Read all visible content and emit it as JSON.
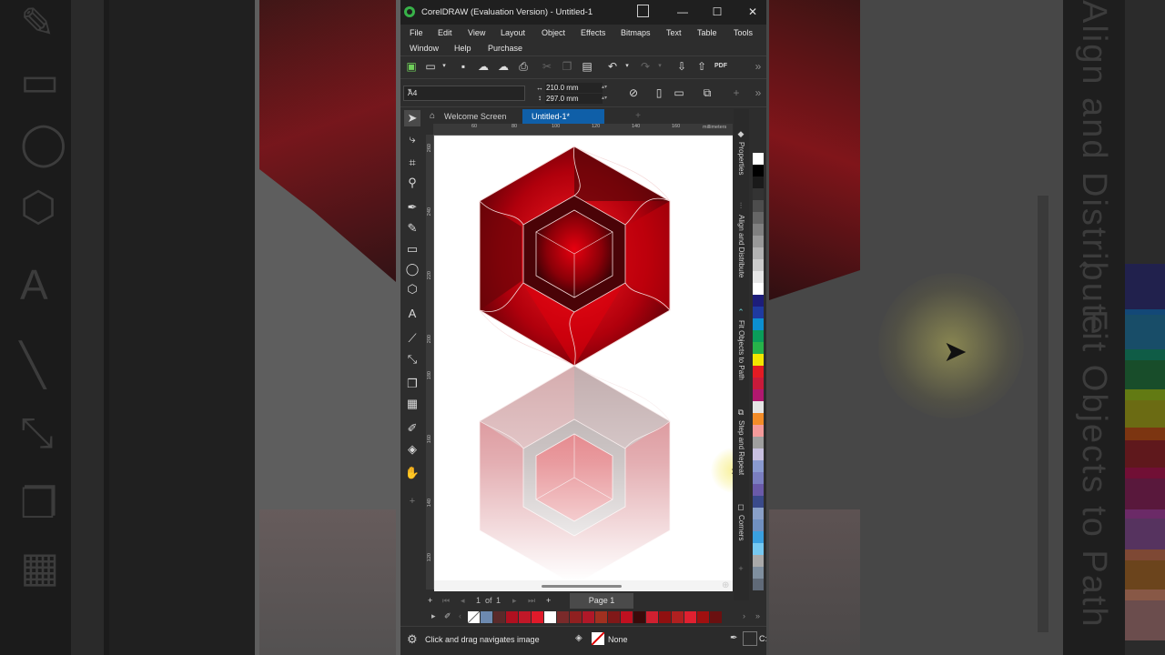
{
  "window": {
    "title": "CorelDRAW (Evaluation Version) - Untitled-1",
    "controls": {
      "minimize": "—",
      "maximize": "☐",
      "close": "✕"
    }
  },
  "menu": [
    "File",
    "Edit",
    "View",
    "Layout",
    "Object",
    "Effects",
    "Bitmaps",
    "Text",
    "Table",
    "Tools",
    "Window",
    "Help",
    "Purchase"
  ],
  "toolbar": {
    "pdf_label": "PDF",
    "icons": [
      "new-document-icon",
      "open-icon",
      "save-icon",
      "cloud-upload-icon",
      "cloud-download-icon",
      "print-icon",
      "cut-icon",
      "copy-icon",
      "paste-icon",
      "undo-icon",
      "redo-icon",
      "import-icon",
      "export-icon",
      "publish-pdf-icon"
    ]
  },
  "property_bar": {
    "page_size": "A4",
    "width": "210.0 mm",
    "height": "297.0 mm"
  },
  "tabs": {
    "welcome": "Welcome Screen",
    "document": "Untitled-1*"
  },
  "rulers": {
    "units": "millimeters",
    "horizontal_ticks": [
      "60",
      "80",
      "100",
      "120",
      "140",
      "160"
    ],
    "vertical_ticks": [
      "260",
      "240",
      "220",
      "200",
      "180",
      "160",
      "140",
      "120"
    ]
  },
  "dockers": [
    "Properties",
    "Align and Distribute",
    "Fit Objects to Path",
    "Step and Repeat",
    "Corners"
  ],
  "page_nav": {
    "current": "1",
    "of_label": "of",
    "total": "1",
    "page_tab": "Page 1"
  },
  "status": {
    "hint": "Click and drag navigates image",
    "fill": "None",
    "outline_cut": "C:"
  },
  "colors": {
    "accent": "#0f5fa8",
    "app_logo": "#38b249",
    "artwork_red": "#d0000d",
    "artwork_dark": "#3a0508"
  },
  "palette": [
    "#ffffff",
    "#000000",
    "#1a1a1a",
    "#333333",
    "#4d4d4d",
    "#666666",
    "#808080",
    "#999999",
    "#b3b3b3",
    "#cccccc",
    "#e6e6e6",
    "#ffffff",
    "#1d1d7a",
    "#1f3aa0",
    "#0c8fd0",
    "#0a9d5a",
    "#27b34a",
    "#f2e600",
    "#e31b23",
    "#c81a3a",
    "#b0186f",
    "#e4e4e4",
    "#f28c28",
    "#f39a9a",
    "#9f9f9f",
    "#c8c0e0",
    "#8a9ad0",
    "#7a7ec0",
    "#6a5aa8",
    "#3a4a8a",
    "#8aa0c8",
    "#7090c0",
    "#3aa0e0",
    "#76c8f0",
    "#a9a9a9",
    "#7f8f9f",
    "#606a78"
  ],
  "document_palette": [
    "#6d8ab0",
    "#5a2a2a",
    "#b01020",
    "#c01828",
    "#e01a2a",
    "#ffffff",
    "#7a2a2a",
    "#902020",
    "#b01828",
    "#a03020",
    "#801818",
    "#c01020",
    "#3a0a0a",
    "#d02030",
    "#901010",
    "#b02020",
    "#e02030",
    "#a01010",
    "#6a1010"
  ]
}
